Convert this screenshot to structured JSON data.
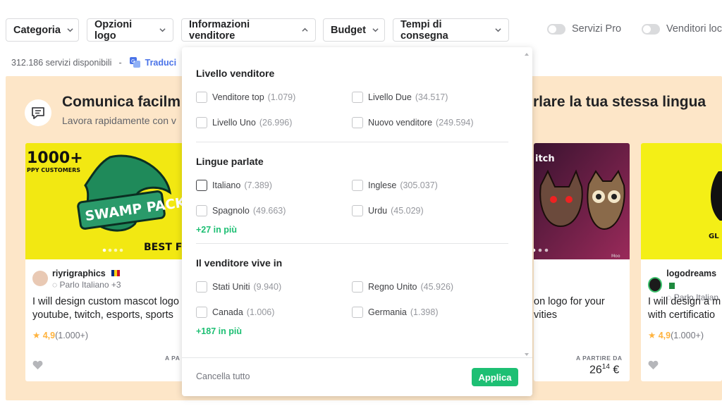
{
  "filters": {
    "categoria": "Categoria",
    "opzioni_logo": "Opzioni logo",
    "informazioni_venditore": "Informazioni venditore",
    "budget": "Budget",
    "tempi_consegna": "Tempi di consegna"
  },
  "toggles": {
    "servizi_pro": "Servizi Pro",
    "venditori_locali": "Venditori loc"
  },
  "results": {
    "count": "312.186 servizi disponibili",
    "dash": "-",
    "translate": "Traduci"
  },
  "banner": {
    "title": "Comunica facilm",
    "title_right": "rlare la tua stessa lingua",
    "subtitle": "Lavora rapidamente con v"
  },
  "cards": [
    {
      "image_text_top": "1000+",
      "image_text_sub": "PPY CUSTOMERS",
      "image_text_mid": "SWAMP PACKS",
      "image_text_bottom": "BEST F",
      "seller": "riyrigraphics",
      "language": "Parlo Italiano +3",
      "title_line1": "I will design custom mascot logo",
      "title_line2": "youtube, twitch, esports, sports",
      "score": "4,9",
      "reviews": "(1.000+)",
      "price_label": "A PA"
    },
    {
      "image_text_top": "itch",
      "title_line1": "on logo for your",
      "title_line2": "vities",
      "price_label": "A PARTIRE DA",
      "price_main": "26",
      "price_cents": "14",
      "price_currency": "€",
      "image_watermark": "Moo"
    },
    {
      "image_text_mid": "GL",
      "seller": "logodreams",
      "language": "Parlo Italian",
      "title_line1": "I will design a m",
      "title_line2": "with certificatio",
      "score": "4,9",
      "reviews": "(1.000+)"
    }
  ],
  "dropdown": {
    "sections": [
      {
        "title": "Livello venditore",
        "options": [
          {
            "label": "Venditore top",
            "count": "(1.079)"
          },
          {
            "label": "Livello Due",
            "count": "(34.517)"
          },
          {
            "label": "Livello Uno",
            "count": "(26.996)"
          },
          {
            "label": "Nuovo venditore",
            "count": "(249.594)"
          }
        ]
      },
      {
        "title": "Lingue parlate",
        "options": [
          {
            "label": "Italiano",
            "count": "(7.389)"
          },
          {
            "label": "Inglese",
            "count": "(305.037)"
          },
          {
            "label": "Spagnolo",
            "count": "(49.663)"
          },
          {
            "label": "Urdu",
            "count": "(45.029)"
          }
        ],
        "more": "+27 in più"
      },
      {
        "title": "Il venditore vive in",
        "options": [
          {
            "label": "Stati Uniti",
            "count": "(9.940)"
          },
          {
            "label": "Regno Unito",
            "count": "(45.926)"
          },
          {
            "label": "Canada",
            "count": "(1.006)"
          },
          {
            "label": "Germania",
            "count": "(1.398)"
          }
        ],
        "more": "+187 in più"
      }
    ],
    "clear_all": "Cancella tutto",
    "apply": "Applica"
  },
  "colors": {
    "accent_green": "#1dbf73",
    "banner_bg": "#fde6c8",
    "rating_star": "#ffb33e",
    "translate_blue": "#4a73e8"
  }
}
